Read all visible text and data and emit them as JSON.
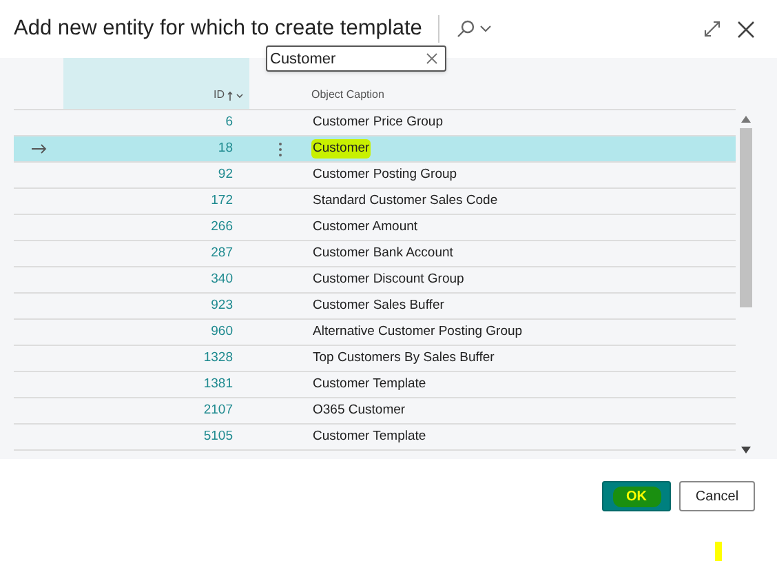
{
  "dialog": {
    "title": "Add new entity for which to create template"
  },
  "search": {
    "value": "Customer"
  },
  "table": {
    "columns": [
      {
        "label": "ID",
        "sorted_ascending": true
      },
      {
        "label": "Object Caption"
      }
    ],
    "rows": [
      {
        "id": "6",
        "caption": "Customer Price Group",
        "selected": false,
        "highlighted": false
      },
      {
        "id": "18",
        "caption": "Customer",
        "selected": true,
        "highlighted": true
      },
      {
        "id": "92",
        "caption": "Customer Posting Group",
        "selected": false,
        "highlighted": false
      },
      {
        "id": "172",
        "caption": "Standard Customer Sales Code",
        "selected": false,
        "highlighted": false
      },
      {
        "id": "266",
        "caption": "Customer Amount",
        "selected": false,
        "highlighted": false
      },
      {
        "id": "287",
        "caption": "Customer Bank Account",
        "selected": false,
        "highlighted": false
      },
      {
        "id": "340",
        "caption": "Customer Discount Group",
        "selected": false,
        "highlighted": false
      },
      {
        "id": "923",
        "caption": "Customer Sales Buffer",
        "selected": false,
        "highlighted": false
      },
      {
        "id": "960",
        "caption": "Alternative Customer Posting Group",
        "selected": false,
        "highlighted": false
      },
      {
        "id": "1328",
        "caption": "Top Customers By Sales Buffer",
        "selected": false,
        "highlighted": false
      },
      {
        "id": "1381",
        "caption": "Customer Template",
        "selected": false,
        "highlighted": false
      },
      {
        "id": "2107",
        "caption": "O365 Customer",
        "selected": false,
        "highlighted": false
      },
      {
        "id": "5105",
        "caption": "Customer Template",
        "selected": false,
        "highlighted": false
      }
    ]
  },
  "buttons": [
    {
      "label": "OK",
      "kind": "primary",
      "highlighted": true
    },
    {
      "label": "Cancel",
      "kind": "secondary",
      "highlighted": false
    }
  ]
}
